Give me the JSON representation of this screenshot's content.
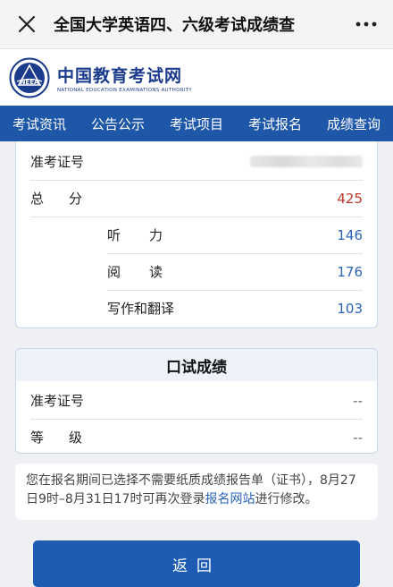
{
  "window": {
    "title": "全国大学英语四、六级考试成绩查"
  },
  "site": {
    "logo_cn": "中国教育考试网",
    "logo_en": "NATIONAL EDUCATION EXAMINATIONS AUTHORITY",
    "seal_text": "NEEA"
  },
  "nav": {
    "items": [
      "考试资讯",
      "公告公示",
      "考试项目",
      "考试报名",
      "成绩查询"
    ]
  },
  "written": {
    "ticket_label": "准考证号",
    "ticket_value_hidden": true,
    "total_label": "总分",
    "total": "425",
    "listening_label": "听力",
    "listening": "146",
    "reading_label": "阅读",
    "reading": "176",
    "writing_label": "写作和翻译",
    "writing": "103"
  },
  "oral": {
    "title": "口试成绩",
    "ticket_label": "准考证号",
    "ticket_value": "--",
    "grade_label": "等级",
    "grade_value": "--"
  },
  "notice": {
    "text_before": "您在报名期间已选择不需要纸质成绩报告单（证书），8月27日9时–8月31日17时可再次登录",
    "link": "报名网站",
    "text_after": "进行修改。"
  },
  "actions": {
    "back_label": "返回"
  },
  "colors": {
    "nav_blue": "#1e56a8",
    "score_blue": "#2a64b8",
    "total_red": "#c0392b"
  }
}
